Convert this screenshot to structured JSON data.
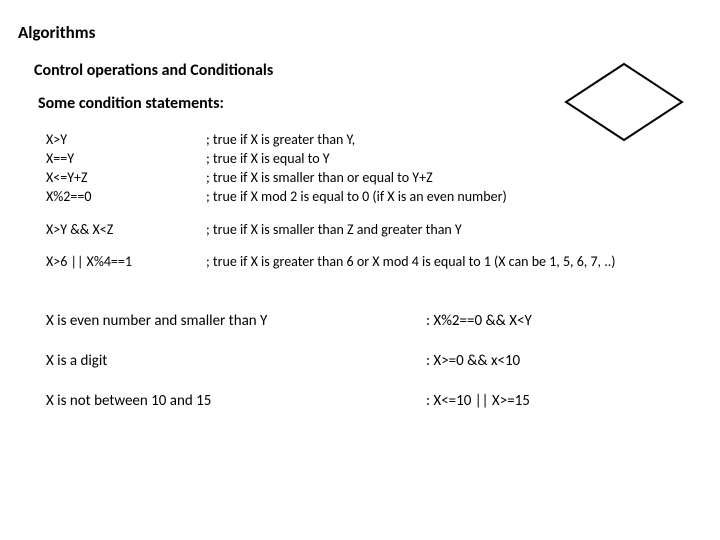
{
  "title": "Algorithms",
  "subtitle": "Control operations and Conditionals",
  "subsub": "Some condition statements:",
  "examples": [
    {
      "expr": "X>Y",
      "desc": "; true if X is greater than Y,"
    },
    {
      "expr": "X==Y",
      "desc": "; true if X is equal to Y"
    },
    {
      "expr": "X<=Y+Z",
      "desc": "; true if X is smaller than or equal to  Y+Z"
    },
    {
      "expr": "X%2==0",
      "desc": "; true if X mod 2 is equal to 0 (if X is an even number)"
    }
  ],
  "example_and": {
    "expr": "X>Y && X<Z",
    "desc": "; true if X is smaller than Z and greater than Y"
  },
  "example_or": {
    "expr": "X>6 || X%4==1",
    "desc": "; true if X is greater than 6 or  X mod 4 is equal to 1 (X can be 1, 5, 6, 7, ..)"
  },
  "qa": [
    {
      "q": "X is even number and smaller than Y",
      "a": ":  X%2==0 && X<Y"
    },
    {
      "q": "X is a digit",
      "a": ": X>=0 && x<10"
    },
    {
      "q": "X is not between 10 and 15",
      "a": ": X<=10 || X>=15"
    }
  ]
}
